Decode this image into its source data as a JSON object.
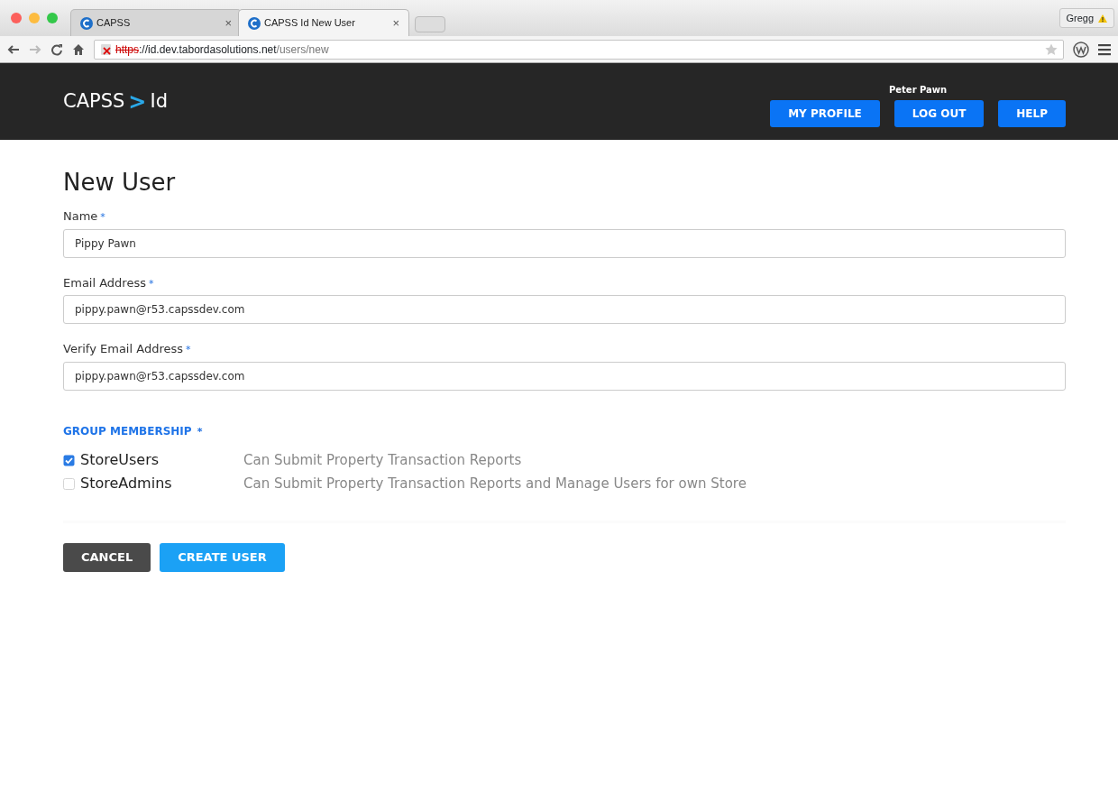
{
  "browser": {
    "tabs": [
      {
        "title": "CAPSS",
        "close": "×",
        "selected": false
      },
      {
        "title": "CAPSS Id New User",
        "close": "×",
        "selected": true
      }
    ],
    "profile": "Gregg",
    "url": {
      "scheme": "https",
      "host": "://id.dev.tabordasolutions.net",
      "path": "/users/new"
    }
  },
  "header": {
    "logo": {
      "left": "CAPSS",
      "sep": ">",
      "right": "Id"
    },
    "user": "Peter Pawn",
    "buttons": [
      {
        "label": "MY PROFILE"
      },
      {
        "label": "LOG OUT"
      },
      {
        "label": "HELP"
      }
    ]
  },
  "form": {
    "title": "New User",
    "fields": [
      {
        "label": "Name",
        "required_mark": "*",
        "value": "Pippy Pawn"
      },
      {
        "label": "Email Address",
        "required_mark": "*",
        "value": "pippy.pawn@r53.capssdev.com"
      },
      {
        "label": "Verify Email Address",
        "required_mark": "*",
        "value": "pippy.pawn@r53.capssdev.com"
      }
    ],
    "group_heading": "GROUP MEMBERSHIP",
    "group_required_mark": "*",
    "groups": [
      {
        "name": "StoreUsers",
        "description": "Can Submit Property Transaction Reports",
        "checked": true
      },
      {
        "name": "StoreAdmins",
        "description": "Can Submit Property Transaction Reports and Manage Users for own Store",
        "checked": false
      }
    ],
    "actions": [
      {
        "label": "CANCEL",
        "kind": "secondary"
      },
      {
        "label": "CREATE USER",
        "kind": "primary"
      }
    ]
  }
}
